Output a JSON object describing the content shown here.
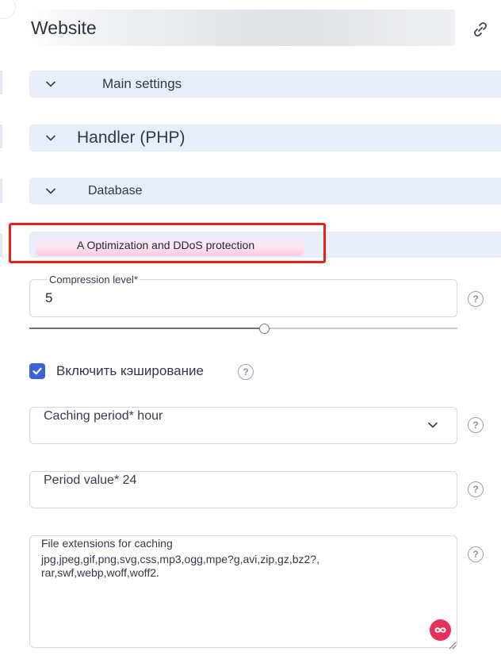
{
  "header": {
    "title": "Website",
    "link_icon": "link-icon"
  },
  "sections": [
    {
      "label": "Main settings",
      "icon": "chevron-down-icon"
    },
    {
      "label": "Handler (PHP)",
      "icon": "chevron-down-icon"
    },
    {
      "label": "Database",
      "icon": "chevron-down-icon"
    },
    {
      "label": "A Optimization and DDoS protection"
    }
  ],
  "compression": {
    "label": "Compression level*",
    "value": "5",
    "slider_fraction": 0.55
  },
  "caching": {
    "checkbox_label": "Включить кэширование",
    "checked": true
  },
  "caching_period": {
    "label": "Caching period* hour",
    "icon": "chevron-down-icon"
  },
  "period_value": {
    "label": "Period value* 24"
  },
  "file_extensions": {
    "label": "File extensions for caching",
    "value": "jpg,jpeg,gif,png,svg,css,mp3,ogg,mpe?g,avi,zip,gz,bz2?,\nrar,swf,webp,woff,woff2.",
    "assist_icon": "infinity-icon"
  },
  "help_text": "?",
  "colors": {
    "section_bg": "#e9eefb",
    "accent": "#3b62d6",
    "highlight_frame": "#e8201c"
  }
}
